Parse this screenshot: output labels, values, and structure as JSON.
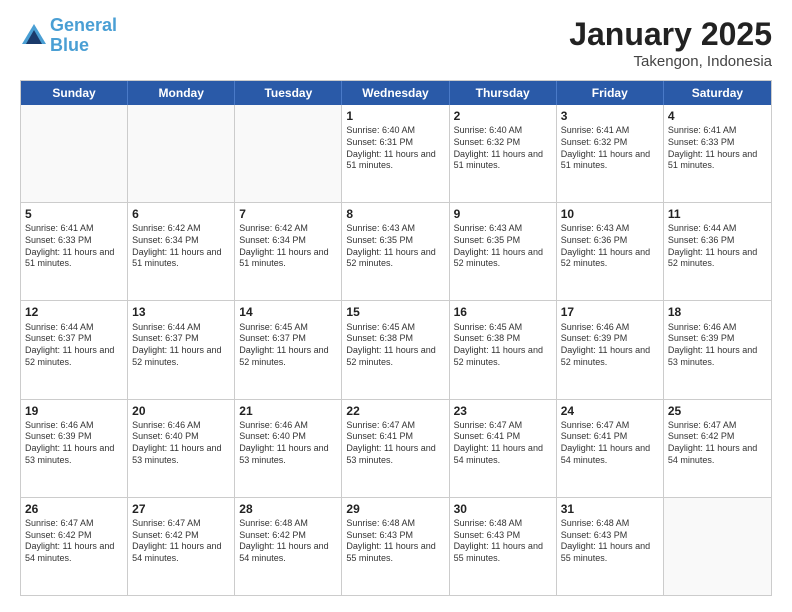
{
  "header": {
    "logo_line1": "General",
    "logo_line2": "Blue",
    "month": "January 2025",
    "location": "Takengon, Indonesia"
  },
  "days_of_week": [
    "Sunday",
    "Monday",
    "Tuesday",
    "Wednesday",
    "Thursday",
    "Friday",
    "Saturday"
  ],
  "weeks": [
    [
      {
        "day": "",
        "empty": true
      },
      {
        "day": "",
        "empty": true
      },
      {
        "day": "",
        "empty": true
      },
      {
        "day": "1",
        "sunrise": "6:40 AM",
        "sunset": "6:31 PM",
        "daylight": "11 hours and 51 minutes."
      },
      {
        "day": "2",
        "sunrise": "6:40 AM",
        "sunset": "6:32 PM",
        "daylight": "11 hours and 51 minutes."
      },
      {
        "day": "3",
        "sunrise": "6:41 AM",
        "sunset": "6:32 PM",
        "daylight": "11 hours and 51 minutes."
      },
      {
        "day": "4",
        "sunrise": "6:41 AM",
        "sunset": "6:33 PM",
        "daylight": "11 hours and 51 minutes."
      }
    ],
    [
      {
        "day": "5",
        "sunrise": "6:41 AM",
        "sunset": "6:33 PM",
        "daylight": "11 hours and 51 minutes."
      },
      {
        "day": "6",
        "sunrise": "6:42 AM",
        "sunset": "6:34 PM",
        "daylight": "11 hours and 51 minutes."
      },
      {
        "day": "7",
        "sunrise": "6:42 AM",
        "sunset": "6:34 PM",
        "daylight": "11 hours and 51 minutes."
      },
      {
        "day": "8",
        "sunrise": "6:43 AM",
        "sunset": "6:35 PM",
        "daylight": "11 hours and 52 minutes."
      },
      {
        "day": "9",
        "sunrise": "6:43 AM",
        "sunset": "6:35 PM",
        "daylight": "11 hours and 52 minutes."
      },
      {
        "day": "10",
        "sunrise": "6:43 AM",
        "sunset": "6:36 PM",
        "daylight": "11 hours and 52 minutes."
      },
      {
        "day": "11",
        "sunrise": "6:44 AM",
        "sunset": "6:36 PM",
        "daylight": "11 hours and 52 minutes."
      }
    ],
    [
      {
        "day": "12",
        "sunrise": "6:44 AM",
        "sunset": "6:37 PM",
        "daylight": "11 hours and 52 minutes."
      },
      {
        "day": "13",
        "sunrise": "6:44 AM",
        "sunset": "6:37 PM",
        "daylight": "11 hours and 52 minutes."
      },
      {
        "day": "14",
        "sunrise": "6:45 AM",
        "sunset": "6:37 PM",
        "daylight": "11 hours and 52 minutes."
      },
      {
        "day": "15",
        "sunrise": "6:45 AM",
        "sunset": "6:38 PM",
        "daylight": "11 hours and 52 minutes."
      },
      {
        "day": "16",
        "sunrise": "6:45 AM",
        "sunset": "6:38 PM",
        "daylight": "11 hours and 52 minutes."
      },
      {
        "day": "17",
        "sunrise": "6:46 AM",
        "sunset": "6:39 PM",
        "daylight": "11 hours and 52 minutes."
      },
      {
        "day": "18",
        "sunrise": "6:46 AM",
        "sunset": "6:39 PM",
        "daylight": "11 hours and 53 minutes."
      }
    ],
    [
      {
        "day": "19",
        "sunrise": "6:46 AM",
        "sunset": "6:39 PM",
        "daylight": "11 hours and 53 minutes."
      },
      {
        "day": "20",
        "sunrise": "6:46 AM",
        "sunset": "6:40 PM",
        "daylight": "11 hours and 53 minutes."
      },
      {
        "day": "21",
        "sunrise": "6:46 AM",
        "sunset": "6:40 PM",
        "daylight": "11 hours and 53 minutes."
      },
      {
        "day": "22",
        "sunrise": "6:47 AM",
        "sunset": "6:41 PM",
        "daylight": "11 hours and 53 minutes."
      },
      {
        "day": "23",
        "sunrise": "6:47 AM",
        "sunset": "6:41 PM",
        "daylight": "11 hours and 54 minutes."
      },
      {
        "day": "24",
        "sunrise": "6:47 AM",
        "sunset": "6:41 PM",
        "daylight": "11 hours and 54 minutes."
      },
      {
        "day": "25",
        "sunrise": "6:47 AM",
        "sunset": "6:42 PM",
        "daylight": "11 hours and 54 minutes."
      }
    ],
    [
      {
        "day": "26",
        "sunrise": "6:47 AM",
        "sunset": "6:42 PM",
        "daylight": "11 hours and 54 minutes."
      },
      {
        "day": "27",
        "sunrise": "6:47 AM",
        "sunset": "6:42 PM",
        "daylight": "11 hours and 54 minutes."
      },
      {
        "day": "28",
        "sunrise": "6:48 AM",
        "sunset": "6:42 PM",
        "daylight": "11 hours and 54 minutes."
      },
      {
        "day": "29",
        "sunrise": "6:48 AM",
        "sunset": "6:43 PM",
        "daylight": "11 hours and 55 minutes."
      },
      {
        "day": "30",
        "sunrise": "6:48 AM",
        "sunset": "6:43 PM",
        "daylight": "11 hours and 55 minutes."
      },
      {
        "day": "31",
        "sunrise": "6:48 AM",
        "sunset": "6:43 PM",
        "daylight": "11 hours and 55 minutes."
      },
      {
        "day": "",
        "empty": true
      }
    ]
  ]
}
